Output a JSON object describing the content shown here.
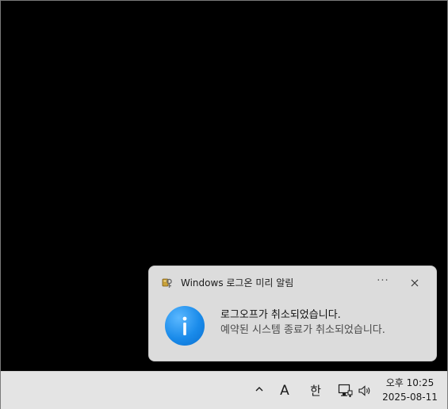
{
  "toast": {
    "app_name": "Windows 로그온 미리 알림",
    "more_label": "···",
    "title": "로그오프가 취소되었습니다.",
    "body": "예약된 시스템 종료가 취소되었습니다.",
    "icons": {
      "app": "key-shield-icon",
      "close": "close-icon",
      "info": "info-icon"
    },
    "accent_color": "#1a8bea"
  },
  "taskbar": {
    "chevron_icon": "chevron-up-icon",
    "ime_mode": "A",
    "ime_lang": "한",
    "network_icon": "network-icon",
    "volume_icon": "volume-icon",
    "time": "오후 10:25",
    "date": "2025-08-11"
  }
}
